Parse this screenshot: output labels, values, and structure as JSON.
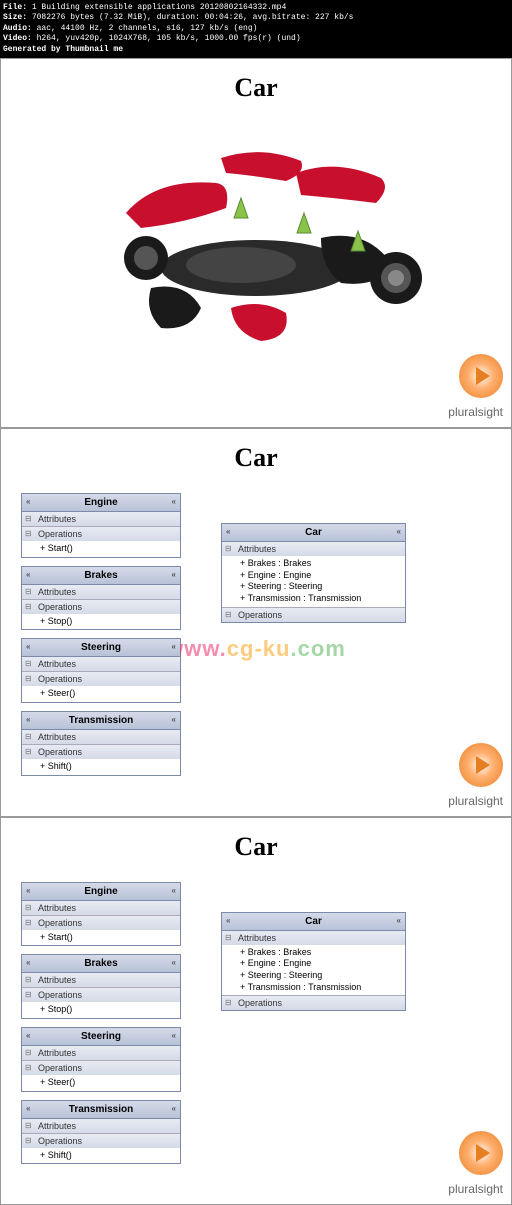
{
  "header": {
    "l1a": "File: ",
    "l1b": "1 Building extensible applications 20120802164332.mp4",
    "l2a": "Size: ",
    "l2b": "7082276 bytes (7.32 MiB), duration: 00:04:26, avg.bitrate: 227 kb/s",
    "l3a": "Audio: ",
    "l3b": "aac, 44100 Hz, 2 channels, s16, 127 kb/s (eng)",
    "l4a": "Video: ",
    "l4b": "h264, yuv420p, 1024X768, 105 kb/s, 1000.00 fps(r) (und)",
    "l5": "Generated by Thumbnail me"
  },
  "shared": {
    "title": "Car",
    "logo": "pluralsight",
    "attrLabel": "Attributes",
    "opLabel": "Operations"
  },
  "boxes": {
    "engine": {
      "name": "Engine",
      "op": "+ Start()"
    },
    "brakes": {
      "name": "Brakes",
      "op": "+ Stop()"
    },
    "steering": {
      "name": "Steering",
      "op": "+ Steer()"
    },
    "transmission": {
      "name": "Transmission",
      "op": "+ Shift()"
    },
    "car": {
      "name": "Car",
      "a1": "+ Brakes : Brakes",
      "a2": "+ Engine : Engine",
      "a3": "+ Steering : Steering",
      "a4": "+ Transmission : Transmission"
    }
  },
  "watermark": {
    "p1": "www.",
    "p2": "cg-ku",
    "p3": ".com"
  }
}
